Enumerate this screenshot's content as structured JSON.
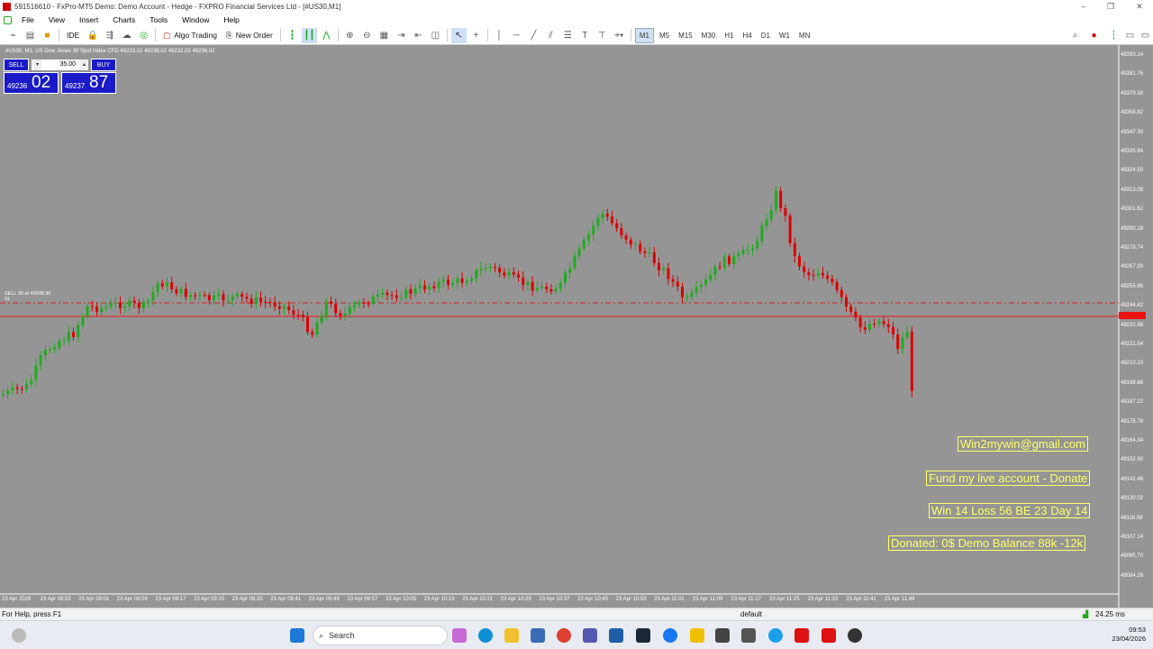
{
  "window": {
    "title": "591516610 - FxPro-MT5 Demo: Demo Account - Hedge - FXPRO Financial Services Ltd - [#US30,M1]"
  },
  "menu": [
    "File",
    "View",
    "Insert",
    "Charts",
    "Tools",
    "Window",
    "Help"
  ],
  "toolbar": {
    "ide_label": "IDE",
    "algo_label": "Algo Trading",
    "new_order_label": "New Order",
    "timeframes": [
      "M1",
      "M5",
      "M15",
      "M30",
      "H1",
      "H4",
      "D1",
      "W1",
      "MN"
    ],
    "active_timeframe": "M1"
  },
  "chart": {
    "info": "#US30, M1:  US Dow Jones 30 Spot Index CFD   49233.02 49238.02 49232.02 49236.02",
    "position_label": "SELL 35 at 49248.90",
    "position_sl": "SL",
    "price_labels": [
      "49393.14",
      "49381.76",
      "49370.38",
      "49358.82",
      "49347.30",
      "49335.94",
      "49324.50",
      "49313.08",
      "49301.62",
      "49290.18",
      "49278.74",
      "49267.30",
      "49255.86",
      "49244.42",
      "49232.98",
      "49221.54",
      "49210.10",
      "49198.66",
      "49187.22",
      "49175.78",
      "49164.34",
      "49152.90",
      "49141.46",
      "49130.02",
      "49118.58",
      "49107.14",
      "49095.70",
      "49084.26"
    ],
    "time_labels": [
      "23 Apr 2026",
      "23 Apr 08:53",
      "23 Apr 09:01",
      "23 Apr 09:09",
      "23 Apr 09:17",
      "23 Apr 09:25",
      "23 Apr 09:33",
      "23 Apr 09:41",
      "23 Apr 09:49",
      "23 Apr 09:57",
      "23 Apr 10:05",
      "23 Apr 10:13",
      "23 Apr 10:21",
      "23 Apr 10:29",
      "23 Apr 10:37",
      "23 Apr 10:45",
      "23 Apr 10:53",
      "23 Apr 11:01",
      "23 Apr 11:09",
      "23 Apr 11:17",
      "23 Apr 11:25",
      "23 Apr 11:33",
      "23 Apr 11:41",
      "23 Apr 11:49"
    ],
    "up_color": "#22aa22",
    "down_color": "#dd0000",
    "bg_color": "#959595"
  },
  "trade_panel": {
    "sell_label": "SELL",
    "buy_label": "BUY",
    "lot": "35.00",
    "sell_small": "49236",
    "sell_big": "02",
    "buy_small": "49237",
    "buy_big": "87"
  },
  "overlay": {
    "email": "Win2mywin@gmail.com",
    "donate": "Fund my live account - Donate",
    "stats": "Win 14  Loss 56  BE 23  Day 14",
    "balance": "Donated: 0$  Demo Balance 88k -12k"
  },
  "statusbar": {
    "help": "For Help, press F1",
    "profile": "default",
    "ping": "24.25 ms"
  },
  "taskbar": {
    "search_label": "Search",
    "time": "09:53",
    "date": "23/04/2026"
  }
}
